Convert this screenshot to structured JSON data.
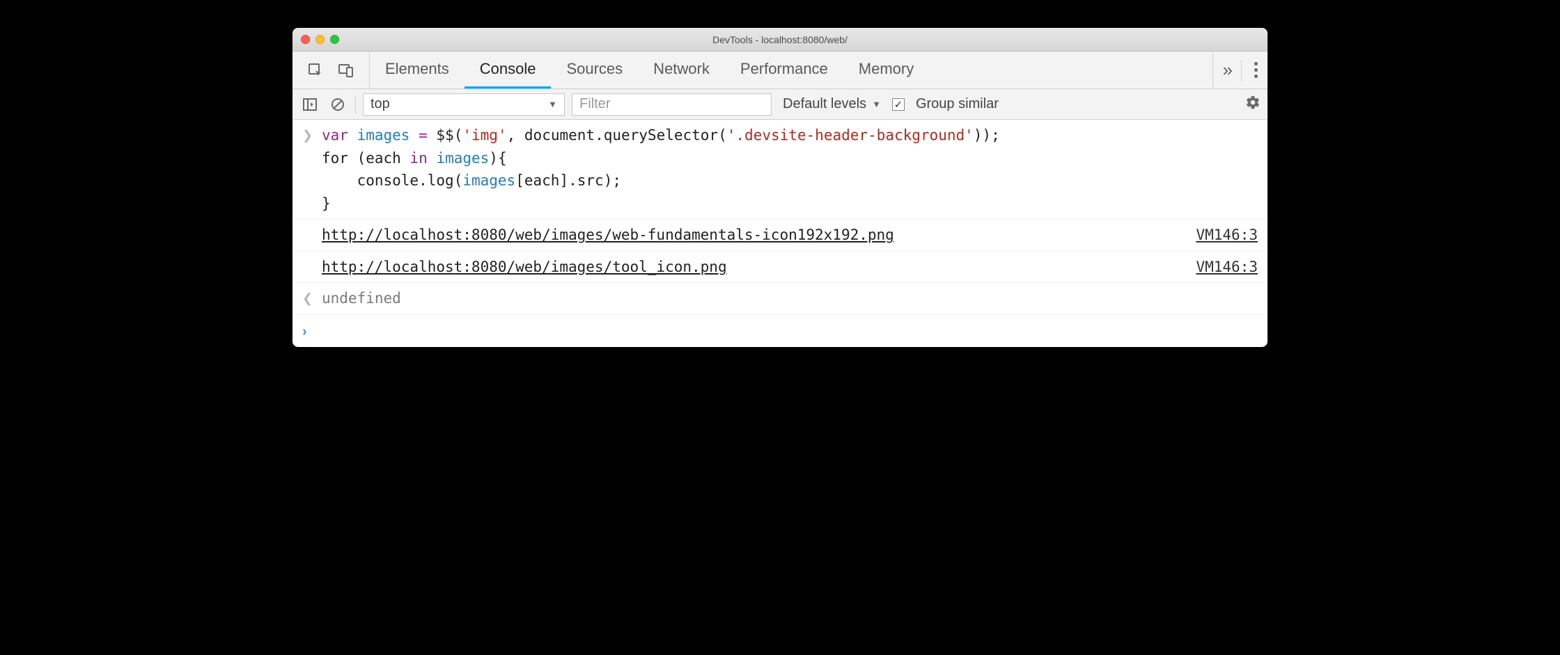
{
  "window": {
    "title": "DevTools - localhost:8080/web/"
  },
  "tabs": {
    "items": [
      {
        "label": "Elements"
      },
      {
        "label": "Console"
      },
      {
        "label": "Sources"
      },
      {
        "label": "Network"
      },
      {
        "label": "Performance"
      },
      {
        "label": "Memory"
      }
    ],
    "active": "Console"
  },
  "toolbar": {
    "context": "top",
    "filter_placeholder": "Filter",
    "levels_label": "Default levels",
    "group_similar_label": "Group similar",
    "group_similar_checked": true
  },
  "code": {
    "tokens": [
      [
        "kw-var",
        "var"
      ],
      [
        "sp",
        " "
      ],
      [
        "ident",
        "images"
      ],
      [
        "sp",
        " "
      ],
      [
        "op",
        "="
      ],
      [
        "sp",
        " "
      ],
      [
        "fn",
        "$$"
      ],
      [
        "fn",
        "("
      ],
      [
        "str",
        "'img'"
      ],
      [
        "fn",
        ","
      ],
      [
        "sp",
        " "
      ],
      [
        "fn",
        "document"
      ],
      [
        "fn",
        "."
      ],
      [
        "fn",
        "querySelector"
      ],
      [
        "fn",
        "("
      ],
      [
        "str",
        "'.devsite-header-background'"
      ],
      [
        "fn",
        "))"
      ],
      [
        "fn",
        ";"
      ],
      [
        "nl",
        ""
      ],
      [
        "kw-for",
        "for"
      ],
      [
        "sp",
        " "
      ],
      [
        "fn",
        "("
      ],
      [
        "fn",
        "each"
      ],
      [
        "sp",
        " "
      ],
      [
        "kw-in",
        "in"
      ],
      [
        "sp",
        " "
      ],
      [
        "ident",
        "images"
      ],
      [
        "fn",
        ")"
      ],
      [
        "fn",
        "{"
      ],
      [
        "nl",
        ""
      ],
      [
        "sp",
        "    "
      ],
      [
        "fn",
        "console"
      ],
      [
        "fn",
        "."
      ],
      [
        "fn",
        "log"
      ],
      [
        "fn",
        "("
      ],
      [
        "ident",
        "images"
      ],
      [
        "fn",
        "["
      ],
      [
        "fn",
        "each"
      ],
      [
        "fn",
        "]"
      ],
      [
        "fn",
        "."
      ],
      [
        "fn",
        "src"
      ],
      [
        "fn",
        ")"
      ],
      [
        "fn",
        ";"
      ],
      [
        "nl",
        ""
      ],
      [
        "fn",
        "}"
      ]
    ]
  },
  "logs": [
    {
      "url": "http://localhost:8080/web/images/web-fundamentals-icon192x192.png",
      "source": "VM146:3"
    },
    {
      "url": "http://localhost:8080/web/images/tool_icon.png",
      "source": "VM146:3"
    }
  ],
  "result": {
    "value": "undefined"
  }
}
